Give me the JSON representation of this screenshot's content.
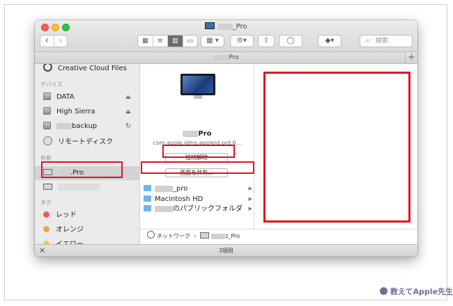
{
  "window": {
    "title": "_Pro",
    "path_title": "Pro",
    "plus": "+"
  },
  "toolbar": {
    "back": "‹",
    "forward": "›",
    "view_icon": "▦",
    "view_list": "≡",
    "view_column": "▥",
    "view_cover": "▭",
    "arrange": "▾",
    "action": "⚙▾",
    "share": "⇪",
    "tag": "◯",
    "dropbox": "◆▾",
    "search_placeholder": "検索"
  },
  "sidebar": {
    "top_item": "Creative Cloud Files",
    "devices_header": "デバイス",
    "devices": [
      {
        "label": "DATA",
        "eject": "⏏"
      },
      {
        "label": "High Sierra",
        "eject": "⏏"
      },
      {
        "label": "backup",
        "eject": "↻"
      },
      {
        "label": "リモートディスク",
        "eject": ""
      }
    ],
    "shared_header": "共有",
    "shared": [
      {
        "label": ".Pro"
      },
      {
        "label": ""
      }
    ],
    "tags_header": "タグ",
    "tags": [
      {
        "label": "レッド",
        "color": "#f25a53"
      },
      {
        "label": "オレンジ",
        "color": "#f6a33d"
      },
      {
        "label": "イエロー",
        "color": "#f4cc40"
      }
    ]
  },
  "computer": {
    "name": "Pro",
    "id": "com.apple.idms.appleid.prd.6...",
    "disconnect_button": "接続解除",
    "share_screen_button": "画面を共有..."
  },
  "volumes": [
    {
      "label": "_pro"
    },
    {
      "label": "Macintosh HD"
    },
    {
      "label": "のパブリックフォルダ"
    }
  ],
  "path": {
    "network": "ネットワーク",
    "sep": "›",
    "computer": "z_Pro"
  },
  "status": {
    "count": "3項目",
    "close": "✕"
  },
  "watermark": "教えてApple先生"
}
